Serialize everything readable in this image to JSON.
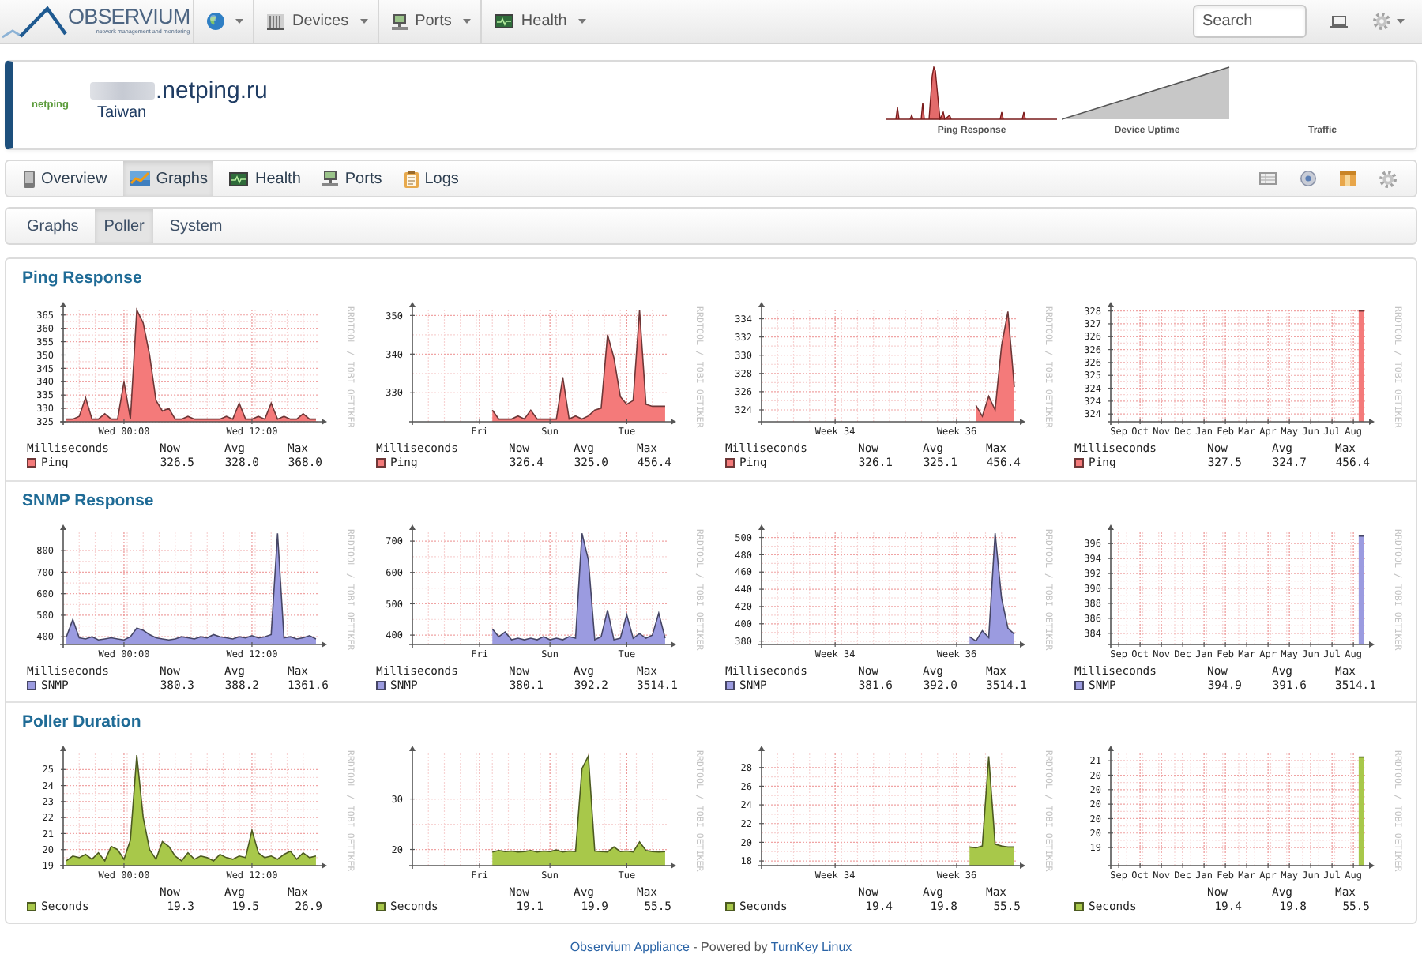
{
  "navbar": {
    "logo": {
      "wordmark": "OBSERVIUM",
      "tagline": "network management and monitoring"
    },
    "menus": [
      {
        "kind": "icon_only"
      },
      {
        "kind": "labeled",
        "label": "Devices"
      },
      {
        "kind": "labeled",
        "label": "Ports"
      },
      {
        "kind": "labeled",
        "label": "Health"
      }
    ],
    "search": {
      "placeholder": "Search"
    }
  },
  "device": {
    "logo_text": "netping",
    "hostname": ".netping.ru",
    "location": "Taiwan",
    "mini_graphs": [
      {
        "kind": "spikes",
        "label": "Ping Response"
      },
      {
        "kind": "ramp",
        "label": "Device Uptime"
      },
      {
        "kind": "empty",
        "label": "Traffic"
      }
    ]
  },
  "tabs": [
    {
      "label": "Overview",
      "selected": false
    },
    {
      "label": "Graphs",
      "selected": true
    },
    {
      "label": "Health",
      "selected": false
    },
    {
      "label": "Ports",
      "selected": false
    },
    {
      "label": "Logs",
      "selected": false
    }
  ],
  "subtabs": [
    {
      "label": "Graphs",
      "selected": false
    },
    {
      "label": "Poller",
      "selected": true
    },
    {
      "label": "System",
      "selected": false
    }
  ],
  "sections": [
    {
      "title": "Ping Response",
      "graphs": [
        {
          "chart_data": {
            "type": "area",
            "grid": true,
            "categories": [
              null,
              null,
              null,
              null,
              null,
              null,
              null,
              null,
              null,
              "Wed 00:00",
              null,
              null,
              null,
              null,
              null,
              null,
              null,
              null,
              null,
              null,
              null,
              null,
              null,
              null,
              null,
              null,
              null,
              null,
              null,
              "Wed 12:00",
              null,
              null,
              null,
              null,
              null,
              null,
              null,
              null,
              null,
              null
            ],
            "ylim": [
              325,
              367
            ],
            "yticks": [
              325,
              330,
              335,
              340,
              345,
              350,
              355,
              360,
              365
            ],
            "series": [
              {
                "name": "Ping",
                "color": "#f47a7a",
                "values": [
                  326,
                  326,
                  327,
                  334,
                  326,
                  326,
                  328,
                  326,
                  326,
                  340,
                  326,
                  366.9,
                  362,
                  350,
                  333,
                  329,
                  330,
                  326,
                  326,
                  327,
                  326,
                  326,
                  326,
                  326,
                  326,
                  327,
                  326,
                  332,
                  326,
                  326,
                  327,
                  326,
                  332,
                  326,
                  327,
                  326,
                  326,
                  328,
                  326,
                  326
                ]
              }
            ]
          },
          "credit": "RRDTOOL / TOBI OETIKER",
          "legend": {
            "heading": "Milliseconds",
            "columns": [
              "Now",
              "Avg",
              "Max"
            ],
            "stats": [
              "326.5",
              "328.0",
              "368.0"
            ]
          }
        },
        {
          "chart_data": {
            "type": "area",
            "grid": true,
            "categories": [
              null,
              null,
              null,
              null,
              null,
              null,
              null,
              null,
              null,
              null,
              "Fri",
              null,
              null,
              null,
              null,
              null,
              null,
              null,
              null,
              null,
              null,
              "Sun",
              null,
              null,
              null,
              null,
              null,
              null,
              null,
              null,
              null,
              null,
              null,
              "Tue",
              null,
              null,
              null,
              null,
              null,
              null
            ],
            "ylim": [
              322.5,
              351.5
            ],
            "yticks": [
              330,
              340,
              350
            ],
            "series": [
              {
                "name": "Ping",
                "color": "#f47a7a",
                "values": [
                  null,
                  null,
                  null,
                  null,
                  null,
                  null,
                  null,
                  null,
                  null,
                  null,
                  null,
                  null,
                  325.5,
                  323.2,
                  323.2,
                  323.2,
                  324,
                  323.2,
                  325.5,
                  323.2,
                  323.2,
                  323.2,
                  323.2,
                  334,
                  323.2,
                  324,
                  323.2,
                  324,
                  325.5,
                  326,
                  345,
                  339,
                  329,
                  327,
                  328,
                  351.4,
                  327,
                  326.5,
                  326.5,
                  326.5
                ]
              }
            ]
          },
          "credit": "RRDTOOL / TOBI OETIKER",
          "legend": {
            "heading": "Milliseconds",
            "columns": [
              "Now",
              "Avg",
              "Max"
            ],
            "stats": [
              "326.4",
              "325.0",
              "456.4"
            ]
          }
        },
        {
          "chart_data": {
            "type": "area",
            "grid": true,
            "categories": [
              null,
              null,
              null,
              null,
              null,
              null,
              null,
              null,
              null,
              null,
              null,
              "Week 34",
              null,
              null,
              null,
              null,
              null,
              null,
              null,
              null,
              null,
              null,
              null,
              null,
              null,
              null,
              null,
              null,
              null,
              null,
              "Week 36",
              null,
              null,
              null,
              null,
              null,
              null,
              null,
              null,
              null
            ],
            "ylim": [
              322.7,
              335
            ],
            "yticks": [
              324,
              326,
              328,
              330,
              332,
              334
            ],
            "series": [
              {
                "name": "Ping",
                "color": "#f47a7a",
                "values": [
                  null,
                  null,
                  null,
                  null,
                  null,
                  null,
                  null,
                  null,
                  null,
                  null,
                  null,
                  null,
                  null,
                  null,
                  null,
                  null,
                  null,
                  null,
                  null,
                  null,
                  null,
                  null,
                  null,
                  null,
                  null,
                  null,
                  null,
                  null,
                  null,
                  null,
                  null,
                  null,
                  null,
                  324.5,
                  323.3,
                  325.5,
                  324,
                  331,
                  334.8,
                  326.5
                ]
              }
            ]
          },
          "credit": "RRDTOOL / TOBI OETIKER",
          "legend": {
            "heading": "Milliseconds",
            "columns": [
              "Now",
              "Avg",
              "Max"
            ],
            "stats": [
              "326.1",
              "325.1",
              "456.4"
            ]
          }
        },
        {
          "chart_data": {
            "type": "area",
            "grid": true,
            "categories": [
              null,
              "Sep",
              null,
              null,
              null,
              "Oct",
              null,
              null,
              null,
              "Nov",
              null,
              null,
              null,
              "Dec",
              null,
              null,
              null,
              "Jan",
              null,
              null,
              null,
              "Feb",
              null,
              null,
              null,
              "Mar",
              null,
              null,
              null,
              "Apr",
              null,
              null,
              null,
              "May",
              null,
              null,
              null,
              "Jun",
              null,
              null,
              null,
              "Jul",
              null,
              null,
              null,
              "Aug",
              null,
              null
            ],
            "ylim": [
              323.2,
              327.55
            ],
            "yticks": [
              {
                "value": 327.5,
                "label": "328"
              },
              {
                "value": 327,
                "label": "327"
              },
              {
                "value": 326.5,
                "label": "326"
              },
              {
                "value": 326,
                "label": "326"
              },
              {
                "value": 325.5,
                "label": "326"
              },
              {
                "value": 325,
                "label": "325"
              },
              {
                "value": 324.5,
                "label": "324"
              },
              {
                "value": 324,
                "label": "324"
              },
              {
                "value": 323.5,
                "label": "324"
              }
            ],
            "series": [
              {
                "name": "Ping",
                "color": "#f47a7a",
                "values": [
                  null,
                  null,
                  null,
                  null,
                  null,
                  null,
                  null,
                  null,
                  null,
                  null,
                  null,
                  null,
                  null,
                  null,
                  null,
                  null,
                  null,
                  null,
                  null,
                  null,
                  null,
                  null,
                  null,
                  null,
                  null,
                  null,
                  null,
                  null,
                  null,
                  null,
                  null,
                  null,
                  null,
                  null,
                  null,
                  null,
                  null,
                  null,
                  null,
                  null,
                  null,
                  null,
                  null,
                  null,
                  null,
                  null,
                  327.5,
                  327.5
                ]
              }
            ]
          },
          "credit": "RRDTOOL / TOBI OETIKER",
          "legend": {
            "heading": "Milliseconds",
            "columns": [
              "Now",
              "Avg",
              "Max"
            ],
            "stats": [
              "327.5",
              "324.7",
              "456.4"
            ]
          }
        }
      ]
    },
    {
      "title": "SNMP Response",
      "graphs": [
        {
          "chart_data": {
            "type": "area",
            "grid": true,
            "categories": [
              null,
              null,
              null,
              null,
              null,
              null,
              null,
              null,
              null,
              "Wed 00:00",
              null,
              null,
              null,
              null,
              null,
              null,
              null,
              null,
              null,
              null,
              null,
              null,
              null,
              null,
              null,
              null,
              null,
              null,
              null,
              "Wed 12:00",
              null,
              null,
              null,
              null,
              null,
              null,
              null,
              null,
              null,
              null
            ],
            "ylim": [
              364,
              885
            ],
            "yticks": [
              400,
              500,
              600,
              700,
              800
            ],
            "series": [
              {
                "name": "SNMP",
                "color": "#9b9be0",
                "values": [
                  400,
                  480,
                  395,
                  390,
                  400,
                  385,
                  390,
                  395,
                  390,
                  385,
                  400,
                  440,
                  430,
                  410,
                  395,
                  390,
                  385,
                  390,
                  400,
                  395,
                  390,
                  400,
                  395,
                  410,
                  400,
                  395,
                  390,
                  400,
                  395,
                  405,
                  395,
                  400,
                  410,
                  880,
                  395,
                  400,
                  390,
                  395,
                  405,
                  390
                ]
              }
            ]
          },
          "credit": "RRDTOOL / TOBI OETIKER",
          "legend": {
            "heading": "Milliseconds",
            "columns": [
              "Now",
              "Avg",
              "Max"
            ],
            "stats": [
              "380.3",
              "388.2",
              "1361.6"
            ]
          }
        },
        {
          "chart_data": {
            "type": "area",
            "grid": true,
            "categories": [
              null,
              null,
              null,
              null,
              null,
              null,
              null,
              null,
              null,
              null,
              "Fri",
              null,
              null,
              null,
              null,
              null,
              null,
              null,
              null,
              null,
              null,
              "Sun",
              null,
              null,
              null,
              null,
              null,
              null,
              null,
              null,
              null,
              null,
              null,
              "Tue",
              null,
              null,
              null,
              null,
              null,
              null
            ],
            "ylim": [
              370,
              728
            ],
            "yticks": [
              400,
              500,
              600,
              700
            ],
            "series": [
              {
                "name": "SNMP",
                "color": "#9b9be0",
                "values": [
                  null,
                  null,
                  null,
                  null,
                  null,
                  null,
                  null,
                  null,
                  null,
                  null,
                  null,
                  null,
                  420,
                  395,
                  410,
                  385,
                  390,
                  385,
                  390,
                  385,
                  395,
                  385,
                  390,
                  385,
                  395,
                  390,
                  725,
                  640,
                  385,
                  395,
                  480,
                  385,
                  390,
                  465,
                  390,
                  405,
                  390,
                  400,
                  470,
                  390
                ]
              }
            ]
          },
          "credit": "RRDTOOL / TOBI OETIKER",
          "legend": {
            "heading": "Milliseconds",
            "columns": [
              "Now",
              "Avg",
              "Max"
            ],
            "stats": [
              "380.1",
              "392.2",
              "3514.1"
            ]
          }
        },
        {
          "chart_data": {
            "type": "area",
            "grid": true,
            "categories": [
              null,
              null,
              null,
              null,
              null,
              null,
              null,
              null,
              null,
              null,
              null,
              "Week 34",
              null,
              null,
              null,
              null,
              null,
              null,
              null,
              null,
              null,
              null,
              null,
              null,
              null,
              null,
              null,
              null,
              null,
              null,
              "Week 36",
              null,
              null,
              null,
              null,
              null,
              null,
              null,
              null,
              null
            ],
            "ylim": [
              376,
              506
            ],
            "yticks": [
              380,
              400,
              420,
              440,
              460,
              480,
              500
            ],
            "series": [
              {
                "name": "SNMP",
                "color": "#9b9be0",
                "values": [
                  null,
                  null,
                  null,
                  null,
                  null,
                  null,
                  null,
                  null,
                  null,
                  null,
                  null,
                  null,
                  null,
                  null,
                  null,
                  null,
                  null,
                  null,
                  null,
                  null,
                  null,
                  null,
                  null,
                  null,
                  null,
                  null,
                  null,
                  null,
                  null,
                  null,
                  null,
                  null,
                  385,
                  380,
                  392,
                  384,
                  505,
                  430,
                  395,
                  388
                ]
              }
            ]
          },
          "credit": "RRDTOOL / TOBI OETIKER",
          "legend": {
            "heading": "Milliseconds",
            "columns": [
              "Now",
              "Avg",
              "Max"
            ],
            "stats": [
              "381.6",
              "392.0",
              "3514.1"
            ]
          }
        },
        {
          "chart_data": {
            "type": "area",
            "grid": true,
            "categories": [
              null,
              "Sep",
              null,
              null,
              null,
              "Oct",
              null,
              null,
              null,
              "Nov",
              null,
              null,
              null,
              "Dec",
              null,
              null,
              null,
              "Jan",
              null,
              null,
              null,
              "Feb",
              null,
              null,
              null,
              "Mar",
              null,
              null,
              null,
              "Apr",
              null,
              null,
              null,
              "May",
              null,
              null,
              null,
              "Jun",
              null,
              null,
              null,
              "Jul",
              null,
              null,
              null,
              "Aug",
              null,
              null
            ],
            "ylim": [
              382.5,
              397.5
            ],
            "yticks": [
              384,
              386,
              388,
              390,
              392,
              394,
              396
            ],
            "series": [
              {
                "name": "SNMP",
                "color": "#9b9be0",
                "values": [
                  null,
                  null,
                  null,
                  null,
                  null,
                  null,
                  null,
                  null,
                  null,
                  null,
                  null,
                  null,
                  null,
                  null,
                  null,
                  null,
                  null,
                  null,
                  null,
                  null,
                  null,
                  null,
                  null,
                  null,
                  null,
                  null,
                  null,
                  null,
                  null,
                  null,
                  null,
                  null,
                  null,
                  null,
                  null,
                  null,
                  null,
                  null,
                  null,
                  null,
                  null,
                  null,
                  null,
                  null,
                  null,
                  null,
                  397,
                  397
                ]
              }
            ]
          },
          "credit": "RRDTOOL / TOBI OETIKER",
          "legend": {
            "heading": "Milliseconds",
            "columns": [
              "Now",
              "Avg",
              "Max"
            ],
            "stats": [
              "394.9",
              "391.6",
              "3514.1"
            ]
          }
        }
      ]
    },
    {
      "title": "Poller Duration",
      "graphs": [
        {
          "chart_data": {
            "type": "area",
            "grid": true,
            "categories": [
              null,
              null,
              null,
              null,
              null,
              null,
              null,
              null,
              null,
              "Wed 00:00",
              null,
              null,
              null,
              null,
              null,
              null,
              null,
              null,
              null,
              null,
              null,
              null,
              null,
              null,
              null,
              null,
              null,
              null,
              null,
              "Wed 12:00",
              null,
              null,
              null,
              null,
              null,
              null,
              null,
              null,
              null,
              null
            ],
            "ylim": [
              19,
              26
            ],
            "yticks": [
              19,
              20,
              21,
              22,
              23,
              24,
              25
            ],
            "series": [
              {
                "name": "Seconds",
                "color": "#a8c84a",
                "values": [
                  19.3,
                  19.6,
                  19.5,
                  19.7,
                  19.4,
                  19.8,
                  19.3,
                  20.2,
                  20.0,
                  19.4,
                  20.6,
                  25.9,
                  22.0,
                  20.0,
                  19.4,
                  20.5,
                  20.2,
                  19.6,
                  19.3,
                  19.8,
                  19.4,
                  19.6,
                  19.5,
                  19.3,
                  19.7,
                  19.5,
                  19.4,
                  19.6,
                  19.5,
                  21.2,
                  19.8,
                  19.5,
                  19.6,
                  19.4,
                  19.7,
                  19.9,
                  19.4,
                  19.8,
                  19.5,
                  19.6
                ]
              }
            ]
          },
          "credit": "RRDTOOL / TOBI OETIKER",
          "legend": {
            "columns": [
              "Now",
              "Avg",
              "Max"
            ],
            "stats": [
              "19.3",
              "19.5",
              "26.9"
            ]
          }
        },
        {
          "chart_data": {
            "type": "area",
            "grid": true,
            "categories": [
              null,
              null,
              null,
              null,
              null,
              null,
              null,
              null,
              null,
              null,
              "Fri",
              null,
              null,
              null,
              null,
              null,
              null,
              null,
              null,
              null,
              null,
              "Sun",
              null,
              null,
              null,
              null,
              null,
              null,
              null,
              null,
              null,
              null,
              null,
              "Tue",
              null,
              null,
              null,
              null,
              null,
              null
            ],
            "ylim": [
              16.8,
              39
            ],
            "yticks": [
              20,
              30
            ],
            "series": [
              {
                "name": "Seconds",
                "color": "#a8c84a",
                "values": [
                  null,
                  null,
                  null,
                  null,
                  null,
                  null,
                  null,
                  null,
                  null,
                  null,
                  null,
                  null,
                  19.5,
                  19.8,
                  19.6,
                  19.7,
                  19.5,
                  19.6,
                  19.8,
                  19.5,
                  19.7,
                  19.6,
                  19.9,
                  19.5,
                  19.7,
                  19.6,
                  36,
                  38.5,
                  19.7,
                  19.6,
                  19.5,
                  20.5,
                  19.6,
                  19.7,
                  19.5,
                  21.5,
                  19.8,
                  19.6,
                  19.5,
                  19.6
                ]
              }
            ]
          },
          "credit": "RRDTOOL / TOBI OETIKER",
          "legend": {
            "columns": [
              "Now",
              "Avg",
              "Max"
            ],
            "stats": [
              "19.1",
              "19.9",
              "55.5"
            ]
          }
        },
        {
          "chart_data": {
            "type": "area",
            "grid": true,
            "categories": [
              null,
              null,
              null,
              null,
              null,
              null,
              null,
              null,
              null,
              null,
              null,
              "Week 34",
              null,
              null,
              null,
              null,
              null,
              null,
              null,
              null,
              null,
              null,
              null,
              null,
              null,
              null,
              null,
              null,
              null,
              null,
              "Week 36",
              null,
              null,
              null,
              null,
              null,
              null,
              null,
              null,
              null
            ],
            "ylim": [
              17.5,
              29.5
            ],
            "yticks": [
              18,
              20,
              22,
              24,
              26,
              28
            ],
            "series": [
              {
                "name": "Seconds",
                "color": "#a8c84a",
                "values": [
                  null,
                  null,
                  null,
                  null,
                  null,
                  null,
                  null,
                  null,
                  null,
                  null,
                  null,
                  null,
                  null,
                  null,
                  null,
                  null,
                  null,
                  null,
                  null,
                  null,
                  null,
                  null,
                  null,
                  null,
                  null,
                  null,
                  null,
                  null,
                  null,
                  null,
                  null,
                  null,
                  19.5,
                  19.4,
                  19.6,
                  29.2,
                  19.8,
                  19.6,
                  19.5,
                  19.5
                ]
              }
            ]
          },
          "credit": "RRDTOOL / TOBI OETIKER",
          "legend": {
            "columns": [
              "Now",
              "Avg",
              "Max"
            ],
            "stats": [
              "19.4",
              "19.8",
              "55.5"
            ]
          }
        },
        {
          "chart_data": {
            "type": "area",
            "grid": true,
            "categories": [
              null,
              "Sep",
              null,
              null,
              null,
              "Oct",
              null,
              null,
              null,
              "Nov",
              null,
              null,
              null,
              "Dec",
              null,
              null,
              null,
              "Jan",
              null,
              null,
              null,
              "Feb",
              null,
              null,
              null,
              "Mar",
              null,
              null,
              null,
              "Apr",
              null,
              null,
              null,
              "May",
              null,
              null,
              null,
              "Jun",
              null,
              null,
              null,
              "Jul",
              null,
              null,
              null,
              "Aug",
              null,
              null
            ],
            "ylim": [
              19.15,
              20.7
            ],
            "yticks": [
              {
                "value": 20.6,
                "label": "21"
              },
              {
                "value": 20.4,
                "label": "20"
              },
              {
                "value": 20.2,
                "label": "20"
              },
              {
                "value": 20,
                "label": "20"
              },
              {
                "value": 19.8,
                "label": "20"
              },
              {
                "value": 19.6,
                "label": "20"
              },
              {
                "value": 19.4,
                "label": "19"
              }
            ],
            "series": [
              {
                "name": "Seconds",
                "color": "#a8c84a",
                "values": [
                  null,
                  null,
                  null,
                  null,
                  null,
                  null,
                  null,
                  null,
                  null,
                  null,
                  null,
                  null,
                  null,
                  null,
                  null,
                  null,
                  null,
                  null,
                  null,
                  null,
                  null,
                  null,
                  null,
                  null,
                  null,
                  null,
                  null,
                  null,
                  null,
                  null,
                  null,
                  null,
                  null,
                  null,
                  null,
                  null,
                  null,
                  null,
                  null,
                  null,
                  null,
                  null,
                  null,
                  null,
                  null,
                  null,
                  20.65,
                  20.65
                ]
              }
            ]
          },
          "credit": "RRDTOOL / TOBI OETIKER",
          "legend": {
            "columns": [
              "Now",
              "Avg",
              "Max"
            ],
            "stats": [
              "19.4",
              "19.8",
              "55.5"
            ]
          }
        }
      ]
    }
  ],
  "footer": {
    "parts": [
      {
        "kind": "link",
        "text": "Observium Appliance"
      },
      {
        "kind": "text",
        "text": " - Powered by "
      },
      {
        "kind": "link",
        "text": "TurnKey Linux"
      }
    ]
  }
}
